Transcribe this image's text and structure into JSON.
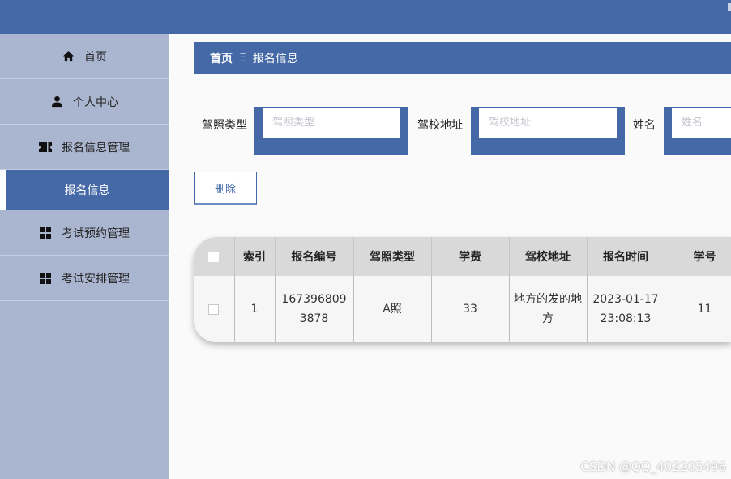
{
  "sidebar": {
    "items": [
      {
        "label": "首页",
        "icon": "home-icon"
      },
      {
        "label": "个人中心",
        "icon": "user-icon"
      },
      {
        "label": "报名信息管理",
        "icon": "ticket-icon"
      },
      {
        "label": "报名信息",
        "icon": ""
      },
      {
        "label": "考试预约管理",
        "icon": "grid-icon"
      },
      {
        "label": "考试安排管理",
        "icon": "grid-icon"
      }
    ]
  },
  "breadcrumb": {
    "home": "首页",
    "separator": "Ξ",
    "current": "报名信息"
  },
  "filters": {
    "license_type": {
      "label": "驾照类型",
      "placeholder": "驾照类型"
    },
    "school_address": {
      "label": "驾校地址",
      "placeholder": "驾校地址"
    },
    "name": {
      "label": "姓名",
      "placeholder": "姓名"
    }
  },
  "toolbar": {
    "delete_label": "删除"
  },
  "table": {
    "headers": [
      "索引",
      "报名编号",
      "驾照类型",
      "学费",
      "驾校地址",
      "报名时间",
      "学号"
    ],
    "rows": [
      [
        "1",
        "1673968093878",
        "A照",
        "33",
        "地方的发的地方",
        "2023-01-17 23:08:13",
        "11"
      ]
    ]
  },
  "colors": {
    "primary": "#4469a6",
    "sidebar": "#aab5cf"
  },
  "watermark": "CSDN @QQ_402205496"
}
